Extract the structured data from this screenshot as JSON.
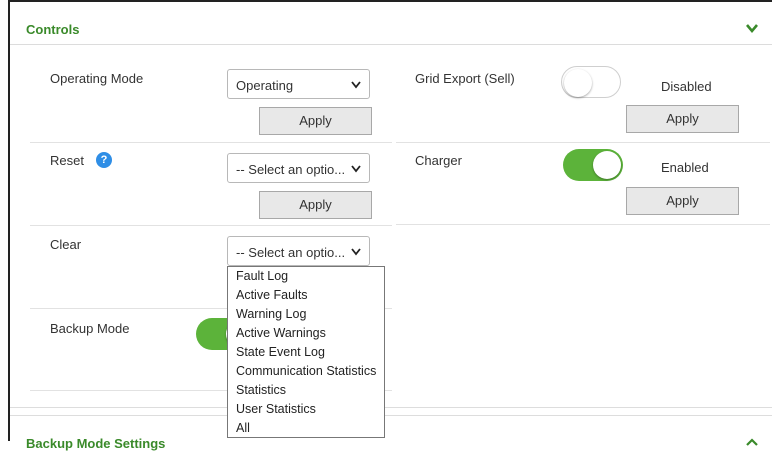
{
  "panel": {
    "title": "Controls",
    "collapse_icon": "chevron-down-icon",
    "accent": "#3a8a2a"
  },
  "operating_mode": {
    "label": "Operating Mode",
    "value": "Operating",
    "apply": "Apply"
  },
  "reset": {
    "label": "Reset",
    "value": "-- Select an optio...",
    "apply": "Apply",
    "help": "?"
  },
  "clear": {
    "label": "Clear",
    "value": "-- Select an optio...",
    "options": [
      "Fault Log",
      "Active Faults",
      "Warning Log",
      "Active Warnings",
      "State Event Log",
      "Communication Statistics",
      "Statistics",
      "User Statistics",
      "All"
    ]
  },
  "backup_mode": {
    "label": "Backup Mode"
  },
  "grid_export": {
    "label": "Grid Export (Sell)",
    "state": "Disabled",
    "apply": "Apply"
  },
  "charger": {
    "label": "Charger",
    "state": "Enabled",
    "apply": "Apply",
    "toggle_color": "#5cb33a"
  },
  "next_panel": {
    "title": "Backup Mode Settings"
  }
}
